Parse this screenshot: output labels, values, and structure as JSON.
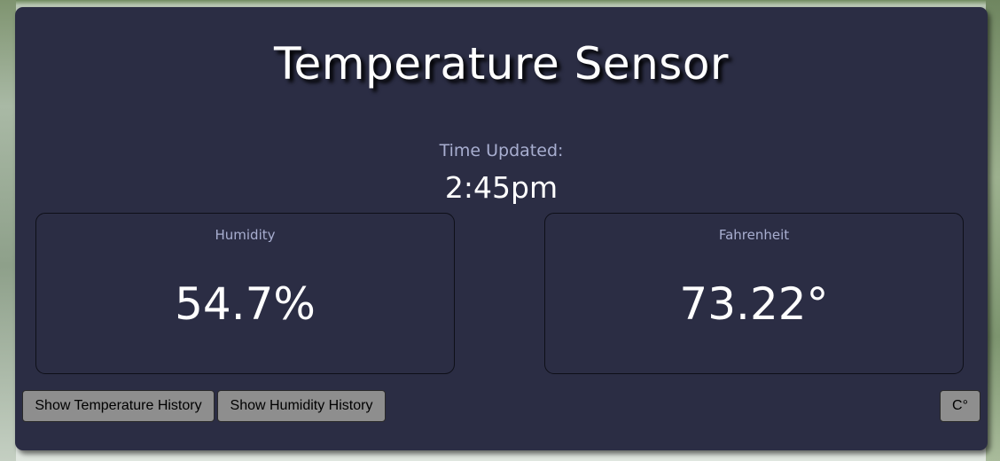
{
  "title": "Temperature Sensor",
  "time": {
    "label": "Time Updated:",
    "value": "2:45pm"
  },
  "metrics": [
    {
      "label": "Humidity",
      "value": "54.7%"
    },
    {
      "label": "Fahrenheit",
      "value": "73.22°"
    }
  ],
  "buttons": {
    "temperature_history": "Show Temperature History",
    "humidity_history": "Show Humidity History",
    "unit_toggle": "C°"
  },
  "colors": {
    "card_background": "#2b2d44",
    "label_color": "#a8aed0",
    "value_color": "#ffffff",
    "button_background": "#8e8e8e"
  }
}
